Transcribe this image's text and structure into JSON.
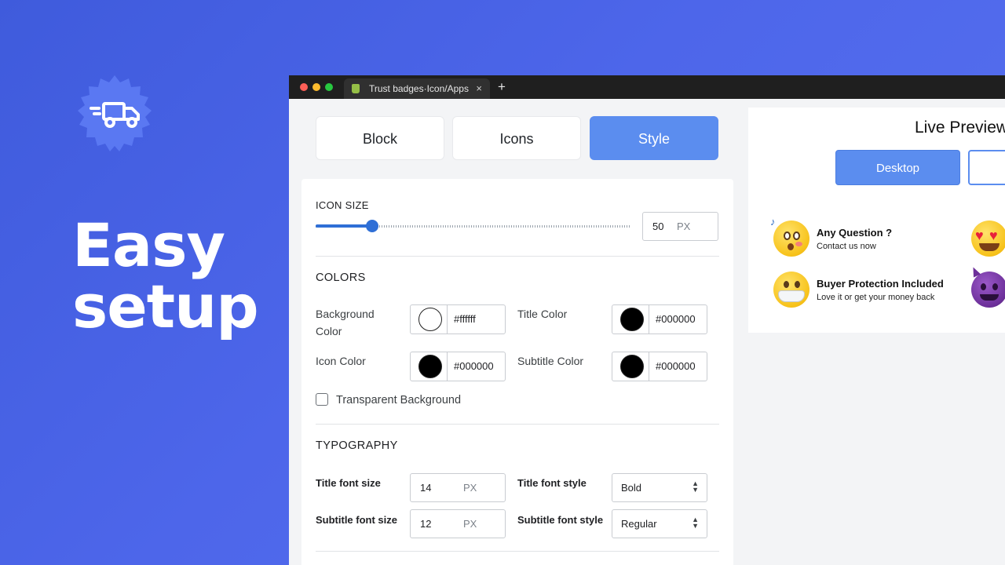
{
  "hero": {
    "title_line1": "Easy",
    "title_line2": "setup",
    "badge_icon": "delivery-truck-icon"
  },
  "browser": {
    "tab_title": "Trust badges·Icon/Apps",
    "tab_close": "×",
    "new_tab": "+"
  },
  "tabs": [
    {
      "label": "Block"
    },
    {
      "label": "Icons"
    },
    {
      "label": "Style",
      "active": true
    }
  ],
  "icon_size": {
    "label": "ICON SIZE",
    "value": "50",
    "unit": "PX",
    "slider_fraction": 0.18
  },
  "colors": {
    "title": "COLORS",
    "background_label": "Background Color",
    "background_value": "#ffffff",
    "title_color_label": "Title Color",
    "title_color_value": "#000000",
    "icon_color_label": "Icon Color",
    "icon_color_value": "#000000",
    "subtitle_color_label": "Subtitle Color",
    "subtitle_color_value": "#000000",
    "transparent_label": "Transparent Background",
    "transparent_checked": false
  },
  "typography": {
    "title": "TYPOGRAPHY",
    "title_font_size_label": "Title font size",
    "title_font_size_value": "14",
    "subtitle_font_size_label": "Subtitle font size",
    "subtitle_font_size_value": "12",
    "unit": "PX",
    "title_font_style_label": "Title font style",
    "title_font_style_value": "Bold",
    "subtitle_font_style_label": "Subtitle font style",
    "subtitle_font_style_value": "Regular"
  },
  "preview": {
    "title": "Live Preview",
    "desktop_label": "Desktop",
    "badges": [
      {
        "title": "Any Question ?",
        "subtitle": "Contact us now",
        "icon": "singing-face-emoji-icon"
      },
      {
        "title": "Buyer Protection Included",
        "subtitle": "Love it or get your money back",
        "icon": "mask-face-emoji-icon"
      }
    ]
  },
  "theme": {
    "accent": "#5b8def",
    "slider": "#2f6fd6",
    "background": "#4d66ea"
  }
}
